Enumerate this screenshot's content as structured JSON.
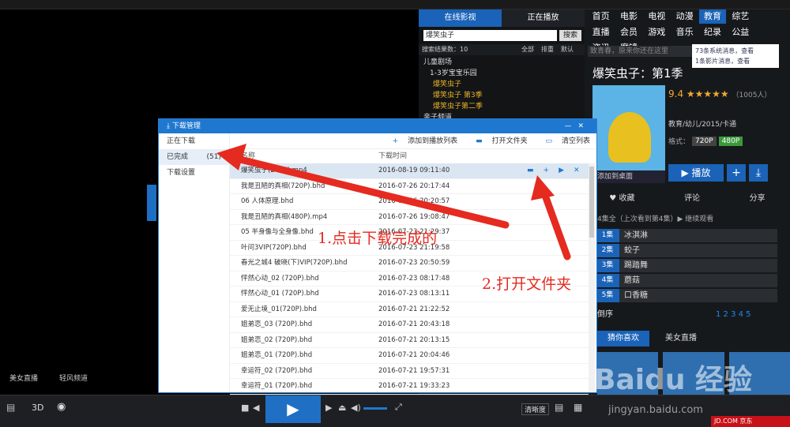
{
  "title_bar": {},
  "left_panel": {
    "tabs": [
      "在线影视",
      "正在播放"
    ],
    "search_value": "爆笑虫子",
    "search_button": "搜索",
    "result_count": "搜索结果数：10",
    "filters": [
      "全部",
      "排重",
      "默认"
    ],
    "tree": [
      {
        "text": "儿童剧场",
        "hl": false
      },
      {
        "text": "1-3岁宝宝乐园",
        "hl": false
      },
      {
        "text": "爆笑虫子",
        "hl": true
      },
      {
        "text": "爆笑虫子 第3季",
        "hl": true
      },
      {
        "text": "爆笑虫子第二季",
        "hl": true
      },
      {
        "text": "亲子频道",
        "hl": false
      }
    ]
  },
  "categories": [
    "首页",
    "电影",
    "电视",
    "动漫",
    "教育",
    "综艺",
    "直播",
    "会员",
    "游戏",
    "音乐",
    "纪录",
    "公益",
    "资讯",
    "魔镜"
  ],
  "active_category": "教育",
  "right_search_placeholder": "致青春，原来你还在这里",
  "messages": [
    "73条系统消息，查看",
    "1条影片消息，查看"
  ],
  "show": {
    "title": "爆笑虫子：第1季",
    "rating": "9.4 ★★★★★",
    "votes": "（1005人）",
    "meta": "教育/幼儿/2015/卡通",
    "format_label": "格式：",
    "formats": [
      "720P",
      "480P"
    ],
    "add_to_desktop": "添加到桌面",
    "play": "▶ 播放",
    "actions": [
      "♥ 收藏",
      "评论",
      "分享"
    ],
    "last_watch": "4集全（上次看到第4集）▶ 继续观看",
    "episodes": [
      {
        "n": "1集",
        "t": "冰淇淋"
      },
      {
        "n": "2集",
        "t": "蛟子"
      },
      {
        "n": "3集",
        "t": "踢踏舞"
      },
      {
        "n": "4集",
        "t": "蘑菇"
      },
      {
        "n": "5集",
        "t": "口香糖"
      }
    ],
    "sort_label": "倒序",
    "pages": "1 2 3 4 5",
    "guess_tab": "猜你喜欢",
    "beauty_tab": "美女直播"
  },
  "video_footer": {
    "beauty": "美女直播",
    "light": "轻风频道"
  },
  "bottom_bar": {
    "clarity": "清晰度",
    "mode3d": "3D"
  },
  "brand": "JD.COM 京东",
  "dialog": {
    "title": "下载管理",
    "sidebar": [
      "正在下载",
      "已完成",
      "下载设置"
    ],
    "done_count": "(51)",
    "tools": [
      "添加到播放列表",
      "打开文件夹",
      "清空列表"
    ],
    "col_name": "名称",
    "col_time": "下载时间",
    "rows": [
      {
        "name": "爆笑虫子(240P).mp4",
        "time": "2016-08-19 09:11:40"
      },
      {
        "name": "我是丑陋的真相(720P).bhd",
        "time": "2016-07-26 20:17:44"
      },
      {
        "name": "06 人体原理.bhd",
        "time": "2016-07-26 20:20:57"
      },
      {
        "name": "我是丑陋的真相(480P).mp4",
        "time": "2016-07-26 19:08:47"
      },
      {
        "name": "05 半身像与全身像.bhd",
        "time": "2016-07-23 21:29:37"
      },
      {
        "name": "叶问3VIP(720P).bhd",
        "time": "2016-07-23 21:19:58"
      },
      {
        "name": "春光之城4 破晓(下)VIP(720P).bhd",
        "time": "2016-07-23 20:50:59"
      },
      {
        "name": "怦然心动_02 (720P).bhd",
        "time": "2016-07-23 08:17:48"
      },
      {
        "name": "怦然心动_01 (720P).bhd",
        "time": "2016-07-23 08:13:11"
      },
      {
        "name": "爱无止境_01(720P).bhd",
        "time": "2016-07-21 21:22:52"
      },
      {
        "name": "姐弟恋_03 (720P).bhd",
        "time": "2016-07-21 20:43:18"
      },
      {
        "name": "姐弟恋_02 (720P).bhd",
        "time": "2016-07-21 20:13:15"
      },
      {
        "name": "姐弟恋_01 (720P).bhd",
        "time": "2016-07-21 20:04:46"
      },
      {
        "name": "幸运符_02 (720P).bhd",
        "time": "2016-07-21 19:57:31"
      },
      {
        "name": "幸运符_01 (720P).bhd",
        "time": "2016-07-21 19:33:23"
      }
    ]
  },
  "annotations": {
    "note1": "1.点击下载完成的",
    "note2": "2.打开文件夹"
  },
  "watermark": {
    "main": "Baidu 经验",
    "sub": "jingyan.baidu.com"
  },
  "colors": {
    "accent": "#1a63b8",
    "annotation": "#e52a20",
    "highlight": "#e7b02a"
  }
}
